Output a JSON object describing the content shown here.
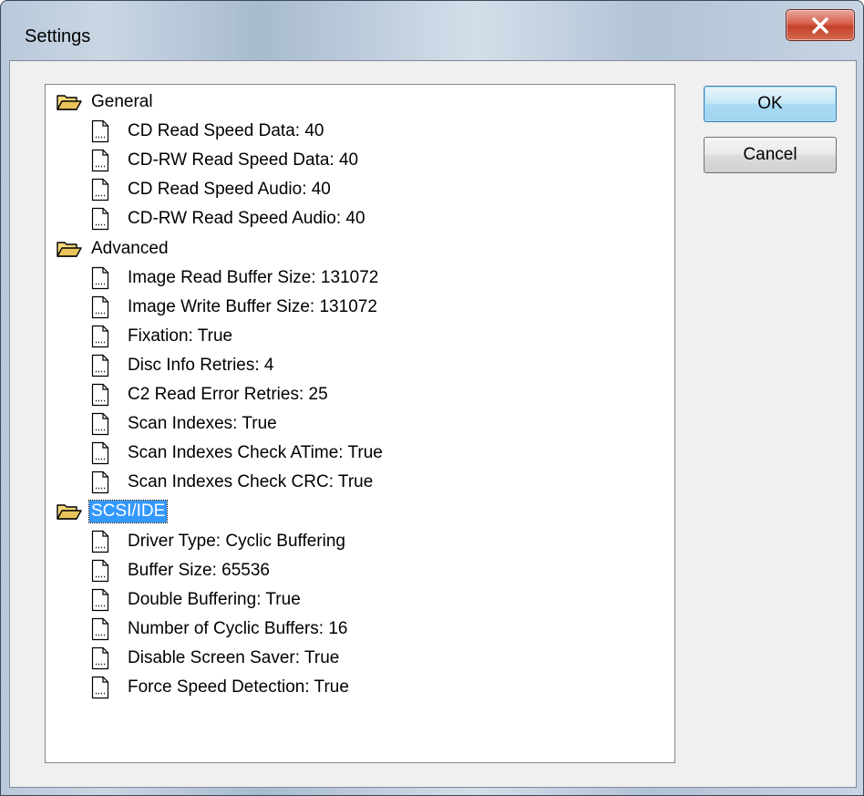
{
  "window": {
    "title": "Settings",
    "close_icon": "close-icon"
  },
  "tree": {
    "groups": [
      {
        "label": "General",
        "icon": "open-folder-icon",
        "selected": false,
        "items": [
          "CD Read Speed Data: 40",
          "CD-RW Read Speed Data: 40",
          "CD Read Speed Audio: 40",
          "CD-RW Read Speed Audio: 40"
        ]
      },
      {
        "label": "Advanced",
        "icon": "open-folder-icon",
        "selected": false,
        "items": [
          "Image Read Buffer Size: 131072",
          "Image Write Buffer Size: 131072",
          "Fixation: True",
          "Disc Info Retries: 4",
          "C2 Read Error Retries: 25",
          "Scan Indexes: True",
          "Scan Indexes Check ATime: True",
          "Scan Indexes Check CRC: True"
        ]
      },
      {
        "label": "SCSI/IDE",
        "icon": "open-folder-icon",
        "selected": true,
        "items": [
          "Driver Type: Cyclic Buffering",
          "Buffer Size: 65536",
          "Double Buffering: True",
          "Number of Cyclic Buffers: 16",
          "Disable Screen Saver: True",
          "Force Speed Detection: True"
        ]
      }
    ],
    "item_icon": "document-icon"
  },
  "buttons": {
    "ok_label": "OK",
    "cancel_label": "Cancel"
  },
  "colors": {
    "selection": "#3399ff",
    "close_button": "#c4402a",
    "folder": "#e8c45a"
  }
}
